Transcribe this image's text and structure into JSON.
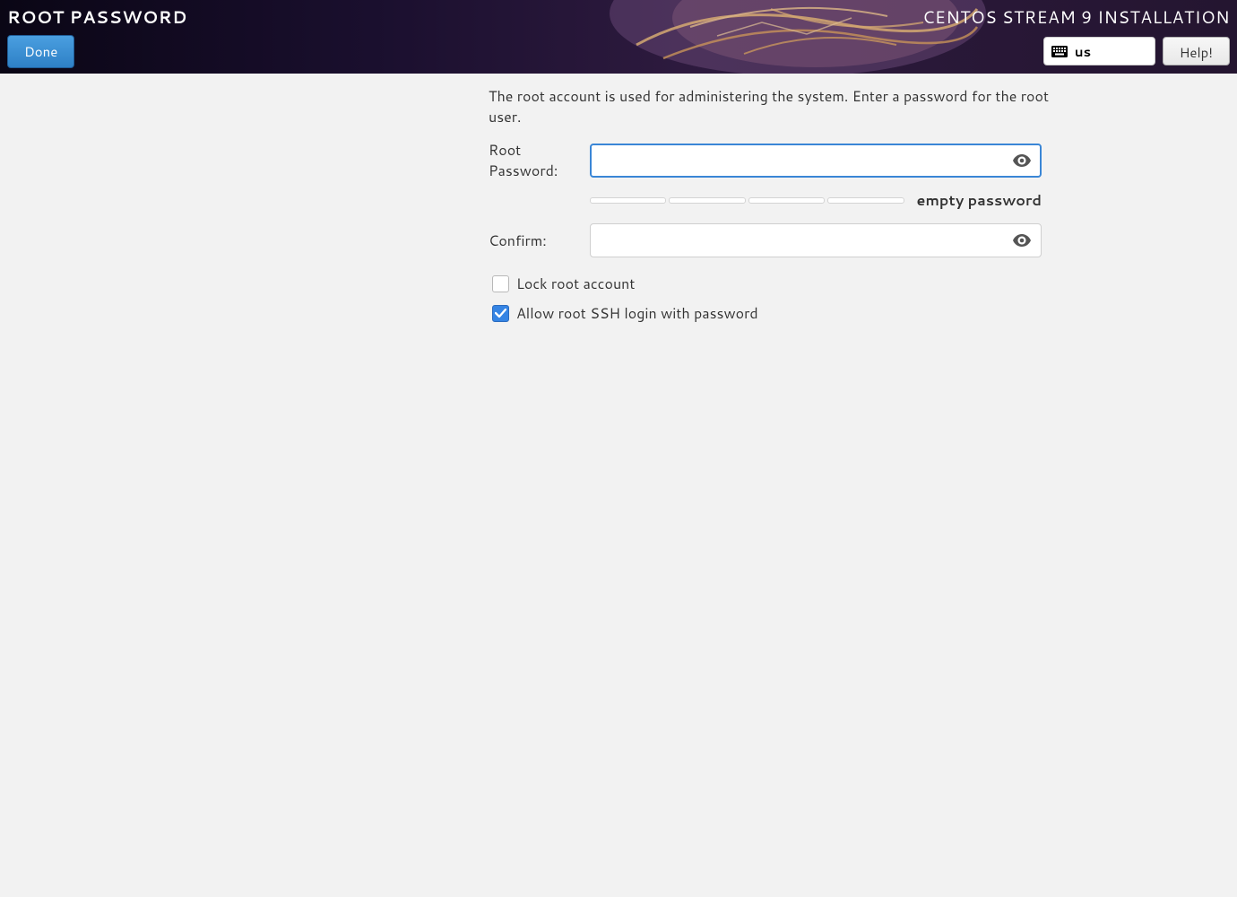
{
  "header": {
    "page_title": "ROOT PASSWORD",
    "install_title": "CENTOS STREAM 9 INSTALLATION",
    "done_label": "Done",
    "help_label": "Help!",
    "keyboard_layout": "us"
  },
  "form": {
    "description": "The root account is used for administering the system.  Enter a password for the root user.",
    "password_label": "Root Password:",
    "confirm_label": "Confirm:",
    "strength_text": "empty password",
    "lock_account_label": "Lock root account",
    "lock_account_checked": false,
    "allow_ssh_label": "Allow root SSH login with password",
    "allow_ssh_checked": true
  }
}
